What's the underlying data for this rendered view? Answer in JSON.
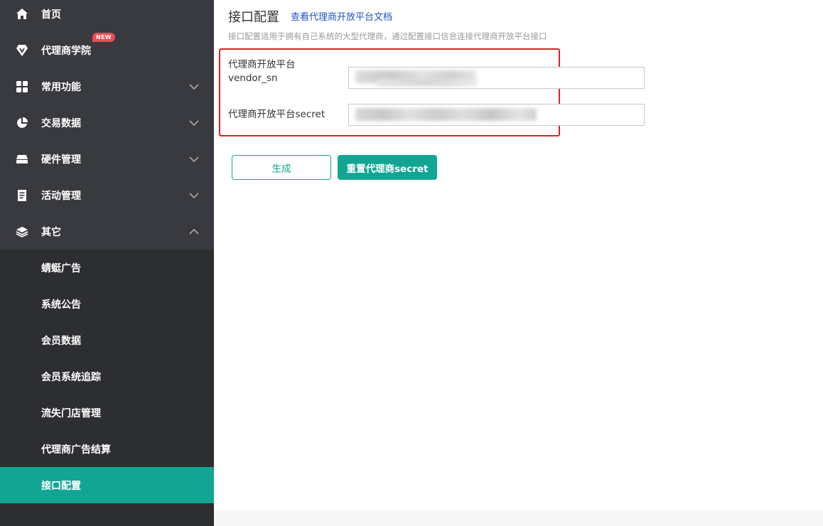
{
  "sidebar": {
    "items": [
      {
        "label": "首页",
        "icon": "home-icon"
      },
      {
        "label": "代理商学院",
        "icon": "academy-icon",
        "badge": "NEW"
      },
      {
        "label": "常用功能",
        "icon": "grid-icon"
      },
      {
        "label": "交易数据",
        "icon": "pie-chart-icon"
      },
      {
        "label": "硬件管理",
        "icon": "hardware-icon"
      },
      {
        "label": "活动管理",
        "icon": "receipt-icon"
      },
      {
        "label": "其它",
        "icon": "layers-icon"
      }
    ],
    "sub_items": [
      {
        "label": "蜻蜓广告"
      },
      {
        "label": "系统公告"
      },
      {
        "label": "会员数据"
      },
      {
        "label": "会员系统追踪"
      },
      {
        "label": "流失门店管理"
      },
      {
        "label": "代理商广告结算"
      },
      {
        "label": "接口配置",
        "active": true
      }
    ]
  },
  "main": {
    "title": "接口配置",
    "doc_link": "查看代理商开放平台文档",
    "description": "接口配置适用于拥有自己系统的大型代理商，通过配置接口信息连接代理商开放平台接口",
    "fields": [
      {
        "label_line1": "代理商开放平台",
        "label_line2": "vendor_sn",
        "value": ""
      },
      {
        "label": "代理商开放平台secret",
        "value": ""
      }
    ],
    "buttons": {
      "generate": "生成",
      "reset_secret": "重置代理商secret"
    }
  },
  "colors": {
    "accent": "#12a594",
    "sidebar_bg": "#393a3f",
    "submenu_bg": "#2d2e32",
    "highlight_box": "#e02020",
    "badge": "#ef4a52",
    "link": "#2050c8"
  }
}
